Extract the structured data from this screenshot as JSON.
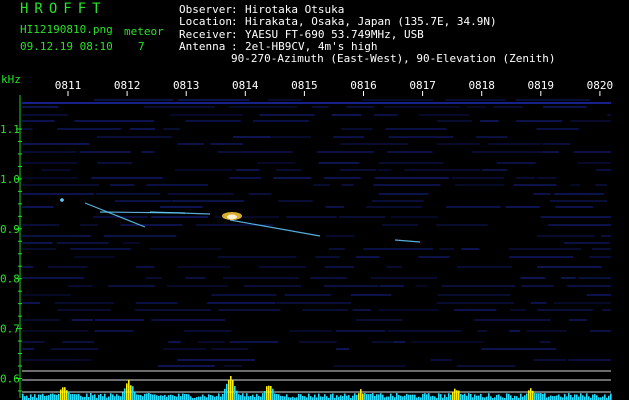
{
  "header": {
    "brand": "HROFFT",
    "filename": "HI12190810.png",
    "datetime": "09.12.19 08:10",
    "meteor_label": "meteor",
    "meteor_count": "7",
    "info": [
      {
        "key": "Observer",
        "value": "Hirotaka Otsuka"
      },
      {
        "key": "Location",
        "value": "Hirakata, Osaka, Japan (135.7E, 34.9N)"
      },
      {
        "key": "Receiver",
        "value": "YAESU FT-690 53.749MHz, USB"
      },
      {
        "key": "Antenna",
        "value": "2el-HB9CV, 4m's high"
      },
      {
        "key": "",
        "value": "90-270-Azimuth (East-West), 90-Elevation (Zenith)"
      }
    ]
  },
  "chart_data": {
    "type": "heatmap",
    "y_unit": "kHz",
    "time_labels": [
      "0811",
      "0812",
      "0813",
      "0814",
      "0815",
      "0816",
      "0817",
      "0818",
      "0819",
      "0820"
    ],
    "freq_ticks": [
      "1.1",
      "1.0",
      "0.9",
      "0.8",
      "0.7",
      "0.6"
    ],
    "ylim": [
      0.58,
      1.16
    ],
    "colors": {
      "background": "#000000",
      "noise_line": "#2233cc",
      "echo": "#66ccff",
      "echo_hot": "#ffcc33",
      "grid": "#ffffff",
      "level_bar": "#22ddff",
      "level_peak": "#ffee00",
      "text_green": "#29e229"
    }
  }
}
